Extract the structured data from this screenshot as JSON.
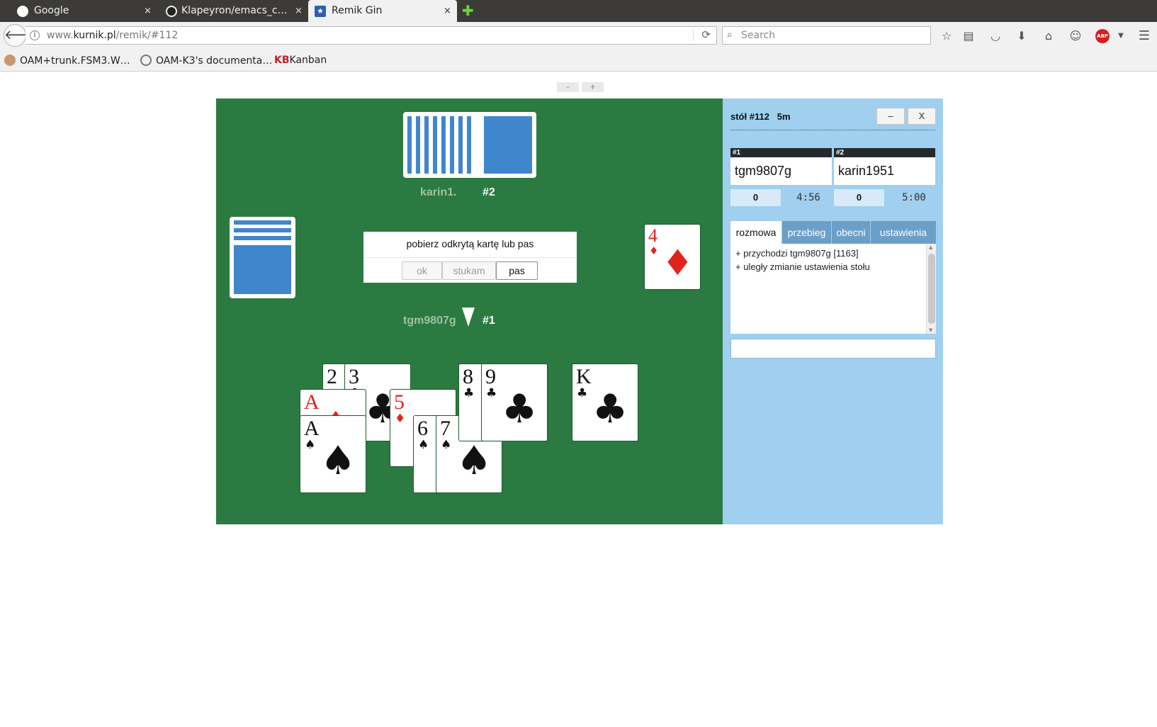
{
  "browser": {
    "tabs": [
      {
        "label": "Google",
        "icon": "google-icon",
        "active": false
      },
      {
        "label": "Klapeyron/emacs_c…",
        "icon": "github-icon",
        "active": false
      },
      {
        "label": "Remik Gin",
        "icon": "kurnik-star-icon",
        "active": true
      }
    ],
    "close_glyph": "×",
    "url_prefix": "www.",
    "url_domain": "kurnik.pl",
    "url_path": "/remik/#112",
    "search_placeholder": "Search",
    "toolbar_icons": [
      "star-icon",
      "reading-list-icon",
      "pocket-icon",
      "download-icon",
      "home-icon",
      "chat-icon",
      "adblock-icon",
      "menu-icon"
    ],
    "adblock_label": "ABP",
    "bookmarks": [
      {
        "label": "OAM+trunk.FSM3.W…"
      },
      {
        "label": "OAM-K3's documenta…"
      },
      {
        "label": "Kanban",
        "prefix": "KB"
      }
    ]
  },
  "page": {
    "zoom_minus": "–",
    "zoom_plus": "+",
    "opponent": {
      "name": "karin1.",
      "number": "#2"
    },
    "me": {
      "name": "tgm9807g",
      "number": "#1"
    },
    "prompt": {
      "text": "pobierz odkrytą kartę lub pas",
      "buttons": [
        "ok",
        "stukam",
        "pas"
      ]
    },
    "discard": {
      "rank": "4",
      "suit": "♦",
      "color": "#e0241b"
    },
    "hand": [
      {
        "rank": "2",
        "suit": "♣"
      },
      {
        "rank": "3",
        "suit": "♣"
      },
      {
        "rank": "A",
        "suit": "♦"
      },
      {
        "rank": "A",
        "suit": "♠"
      },
      {
        "rank": "5",
        "suit": "♦"
      },
      {
        "rank": "6",
        "suit": "♠"
      },
      {
        "rank": "7",
        "suit": "♠"
      },
      {
        "rank": "8",
        "suit": "♣"
      },
      {
        "rank": "9",
        "suit": "♣"
      },
      {
        "rank": "K",
        "suit": "♣"
      }
    ],
    "colors": {
      "felt": "#2b7a41",
      "panel": "#a0cfef",
      "card_back": "#3f86cd",
      "red_suit": "#e0241b"
    }
  },
  "panel": {
    "title": "stół #112   5m",
    "minimize": "–",
    "close": "X",
    "players": [
      {
        "seat": "#1",
        "name": "tgm9807g",
        "score": "0",
        "clock": "4:56"
      },
      {
        "seat": "#2",
        "name": "karin1951",
        "score": "0",
        "clock": "5:00"
      }
    ],
    "tabs": [
      "rozmowa",
      "przebieg",
      "obecni",
      "ustawienia"
    ],
    "chat": [
      "+ przychodzi tgm9807g [1163]",
      "+ uległy zmianie ustawienia stołu"
    ],
    "chat_input": ""
  }
}
